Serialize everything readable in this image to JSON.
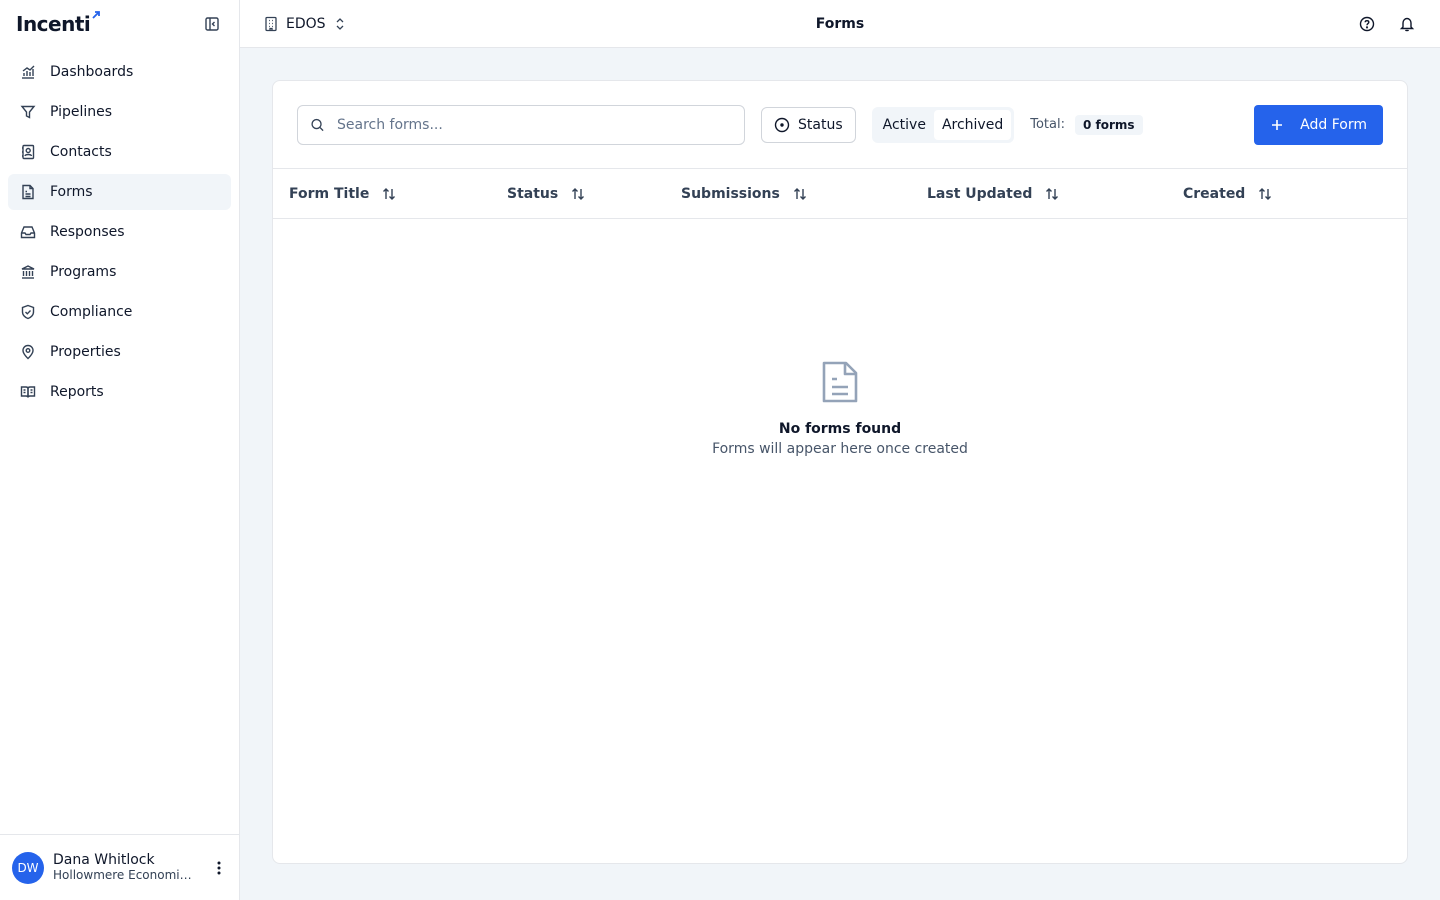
{
  "brand": {
    "name": "Incenti"
  },
  "sidebar": {
    "items": [
      {
        "label": "Dashboards",
        "icon": "chart-icon"
      },
      {
        "label": "Pipelines",
        "icon": "filter-icon"
      },
      {
        "label": "Contacts",
        "icon": "contact-book-icon"
      },
      {
        "label": "Forms",
        "icon": "document-icon",
        "active": true
      },
      {
        "label": "Responses",
        "icon": "inbox-icon"
      },
      {
        "label": "Programs",
        "icon": "landmark-icon"
      },
      {
        "label": "Compliance",
        "icon": "shield-check-icon"
      },
      {
        "label": "Properties",
        "icon": "map-pin-icon"
      },
      {
        "label": "Reports",
        "icon": "book-icon"
      }
    ],
    "user": {
      "initials": "DW",
      "name": "Dana Whitlock",
      "org": "Hollowmere Economic Development"
    }
  },
  "topbar": {
    "org": "EDOS",
    "title": "Forms"
  },
  "toolbar": {
    "search_placeholder": "Search forms...",
    "status_label": "Status",
    "segments": {
      "active": "Active",
      "archived": "Archived"
    },
    "total_label": "Total:",
    "total_value": "0 forms",
    "add_label": "Add Form"
  },
  "table": {
    "columns": [
      "Form Title",
      "Status",
      "Submissions",
      "Last Updated",
      "Created"
    ]
  },
  "empty": {
    "title": "No forms found",
    "subtitle": "Forms will appear here once created"
  },
  "colors": {
    "accent": "#2563eb",
    "background": "#f1f5f9"
  }
}
